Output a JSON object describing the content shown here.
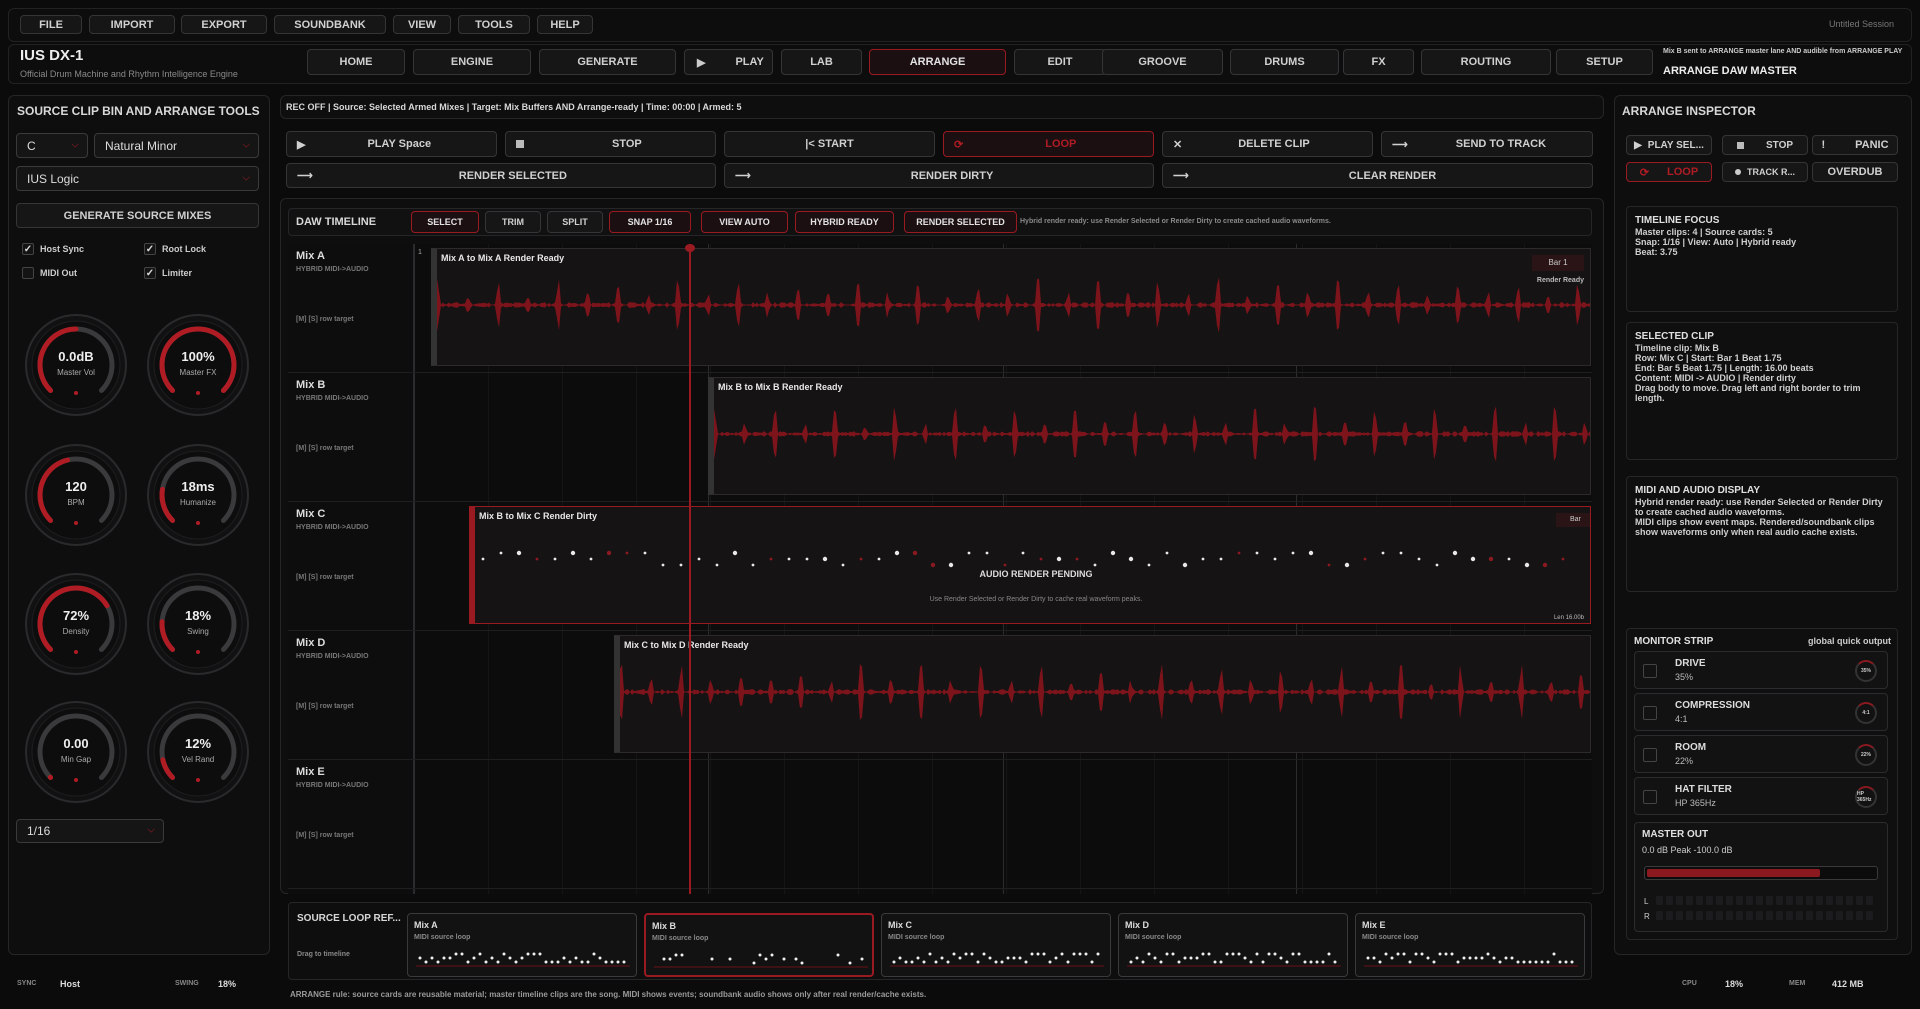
{
  "menu": {
    "items": [
      "FILE",
      "IMPORT",
      "EXPORT",
      "SOUNDBANK",
      "VIEW",
      "TOOLS",
      "HELP"
    ],
    "session": "Untitled Session"
  },
  "app": {
    "title": "IUS DX-1",
    "subtitle": "Official Drum Machine and Rhythm Intelligence Engine"
  },
  "nav": {
    "tabs": [
      "HOME",
      "ENGINE",
      "GENERATE",
      "PLAY",
      "LAB",
      "ARRANGE",
      "EDIT",
      "GROOVE",
      "DRUMS",
      "FX",
      "ROUTING",
      "SETUP"
    ],
    "active": "ARRANGE",
    "status": "Mix B sent to ARRANGE master lane AND audible from ARRANGE PLAY",
    "mode": "ARRANGE DAW MASTER"
  },
  "left": {
    "title": "SOURCE CLIP BIN AND ARRANGE TOOLS",
    "key": "C",
    "scale": "Natural Minor",
    "engine": "IUS Logic",
    "generate": "GENERATE SOURCE MIXES",
    "checks": [
      {
        "label": "Host Sync",
        "on": true
      },
      {
        "label": "Root Lock",
        "on": true
      },
      {
        "label": "MIDI Out",
        "on": false
      },
      {
        "label": "Limiter",
        "on": true
      }
    ],
    "knobs": [
      {
        "value": "0.0dB",
        "label": "Master Vol",
        "level": 0.5
      },
      {
        "value": "100%",
        "label": "Master FX",
        "level": 1.0
      },
      {
        "value": "120",
        "label": "BPM",
        "level": 0.45
      },
      {
        "value": "18ms",
        "label": "Humanize",
        "level": 0.2
      },
      {
        "value": "72%",
        "label": "Density",
        "level": 0.72
      },
      {
        "value": "18%",
        "label": "Swing",
        "level": 0.18
      },
      {
        "value": "0.00",
        "label": "Min Gap",
        "level": 0.0
      },
      {
        "value": "12%",
        "label": "Vel Rand",
        "level": 0.12
      }
    ],
    "grid": "1/16"
  },
  "status_line": "REC OFF | Source: Selected Armed Mixes | Target: Mix Buffers AND Arrange-ready | Time: 00:00 | Armed: 5",
  "transport": {
    "play": "PLAY  Space",
    "stop": "STOP",
    "start": "|< START",
    "loop": "LOOP",
    "delete": "DELETE CLIP",
    "send": "SEND TO TRACK",
    "render_sel": "RENDER SELECTED",
    "render_dirty": "RENDER DIRTY",
    "clear": "CLEAR RENDER"
  },
  "timeline": {
    "title": "DAW TIMELINE",
    "tools": [
      "SELECT",
      "TRIM",
      "SPLIT",
      "SNAP 1/16",
      "VIEW AUTO",
      "HYBRID READY",
      "RENDER SELECTED"
    ],
    "hint": "Hybrid render ready: use Render Selected or Render Dirty to create cached audio waveforms.",
    "bar_marker": "1",
    "tracks": [
      {
        "name": "Mix A",
        "sub": "HYBRID MIDI->AUDIO",
        "target": "[M] [S] row target",
        "clip": "Mix A to Mix A  Render Ready",
        "bar": "Bar 1",
        "tag": "Render Ready"
      },
      {
        "name": "Mix B",
        "sub": "HYBRID MIDI->AUDIO",
        "target": "[M] [S] row target",
        "clip": "Mix B to Mix B  Render Ready"
      },
      {
        "name": "Mix C",
        "sub": "HYBRID MIDI->AUDIO",
        "target": "[M] [S] row target",
        "clip": "Mix B to Mix C  Render Dirty",
        "bar": "Bar",
        "pending": "AUDIO RENDER PENDING",
        "pending_hint": "Use Render Selected or Render Dirty to cache real waveform peaks.",
        "len": "Len 16.00b"
      },
      {
        "name": "Mix D",
        "sub": "HYBRID MIDI->AUDIO",
        "target": "[M] [S] row target",
        "clip": "Mix C to Mix D  Render Ready"
      },
      {
        "name": "Mix E",
        "sub": "HYBRID MIDI->AUDIO",
        "target": "[M] [S] row target"
      }
    ]
  },
  "source": {
    "title": "SOURCE LOOP REF...",
    "hint": "Drag to timeline",
    "cards": [
      {
        "name": "Mix A",
        "sub": "MIDI source loop"
      },
      {
        "name": "Mix B",
        "sub": "MIDI source loop"
      },
      {
        "name": "Mix C",
        "sub": "MIDI source loop"
      },
      {
        "name": "Mix D",
        "sub": "MIDI source loop"
      },
      {
        "name": "Mix E",
        "sub": "MIDI source loop"
      }
    ],
    "rule": "ARRANGE rule: source cards are reusable material; master timeline clips are the song. MIDI shows events; soundbank audio shows only after real render/cache exists."
  },
  "inspector": {
    "title": "ARRANGE INSPECTOR",
    "buttons": [
      "PLAY SEL...",
      "STOP",
      "PANIC",
      "LOOP",
      "TRACK R...",
      "OVERDUB"
    ],
    "focus": {
      "title": "TIMELINE FOCUS",
      "lines": [
        "Master clips: 4 | Source cards: 5",
        "Snap: 1/16 | View: Auto | Hybrid ready",
        "Beat: 3.75"
      ]
    },
    "selected": {
      "title": "SELECTED CLIP",
      "lines": [
        "Timeline clip: Mix B",
        "Row: Mix C | Start: Bar 1 Beat 1.75",
        "End: Bar 5 Beat 1.75 | Length: 16.00 beats",
        "Content: MIDI -> AUDIO | Render dirty",
        "Drag body to move. Drag left and right border to trim length."
      ]
    },
    "display": {
      "title": "MIDI AND AUDIO DISPLAY",
      "lines": [
        "Hybrid render ready: use Render Selected or Render Dirty to create cached audio waveforms.",
        "MIDI clips show event maps. Rendered/soundbank clips show waveforms only when real audio cache exists."
      ]
    },
    "monitor": {
      "title": "MONITOR STRIP",
      "right": "global quick output",
      "items": [
        {
          "name": "DRIVE",
          "value": "35%",
          "dial": "35%"
        },
        {
          "name": "COMPRESSION",
          "value": "4:1",
          "dial": "4:1"
        },
        {
          "name": "ROOM",
          "value": "22%",
          "dial": "22%"
        },
        {
          "name": "HAT FILTER",
          "value": "HP 365Hz",
          "dial": "HP 365Hz"
        }
      ]
    },
    "master": {
      "title": "MASTER OUT",
      "line": "0.0 dB  Peak -100.0 dB",
      "level": 0.75,
      "l": "L",
      "r": "R"
    }
  },
  "footer": {
    "sync_label": "SYNC",
    "sync": "Host",
    "swing_label": "SWING",
    "swing": "18%",
    "cpu_label": "CPU",
    "cpu": "18%",
    "mem_label": "MEM",
    "mem": "412 MB"
  },
  "colors": {
    "accent": "#b01c24",
    "bg": "#0b0b0c"
  }
}
